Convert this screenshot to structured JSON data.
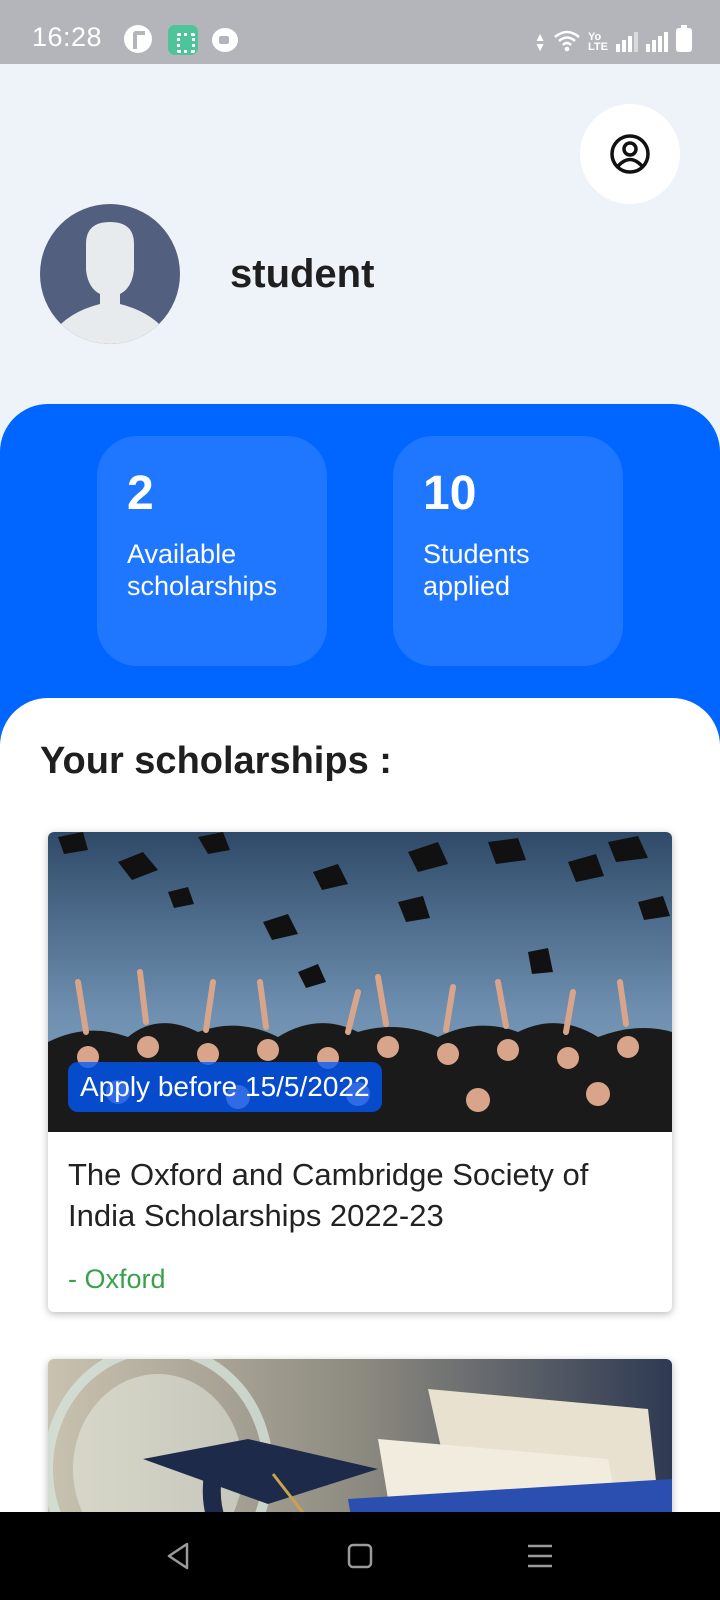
{
  "status_bar": {
    "time": "16:28",
    "lte_label_top": "Yo",
    "lte_label_bottom": "LTE",
    "icons": [
      "app-notification-icon",
      "calculator-app-icon",
      "video-call-icon",
      "data-transfer-icon",
      "wifi-icon",
      "signal-icon",
      "battery-charging-icon"
    ]
  },
  "header": {
    "profile_button_icon": "user-circle-icon",
    "user_name": "student"
  },
  "stats": [
    {
      "value": "2",
      "label_line1": "Available",
      "label_line2": "scholarships"
    },
    {
      "value": "10",
      "label_line1": "Students",
      "label_line2": "applied"
    }
  ],
  "section": {
    "title": "Your scholarships :"
  },
  "scholarships": [
    {
      "deadline": "Apply before 15/5/2022",
      "title": "The Oxford and Cambridge Society of India Scholarships 2022-23",
      "university": "- Oxford",
      "image_subject": "graduates throwing caps"
    },
    {
      "image_subject": "graduation cap on jar with book"
    }
  ],
  "colors": {
    "primary_blue": "#0066ff",
    "card_blue": "#1f76ff",
    "background": "#eef2f9",
    "university_green": "#3aa14a",
    "avatar": "#525f7f"
  },
  "nav_bar": {
    "icons": [
      "back-icon",
      "home-icon",
      "recents-icon"
    ]
  }
}
